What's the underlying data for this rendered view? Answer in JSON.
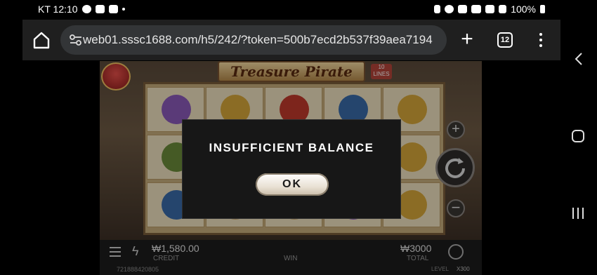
{
  "status_bar": {
    "time": "KT 12:10",
    "battery": "100%"
  },
  "browser": {
    "url": "web01.sssc1688.com/h5/242/?token=500b7ecd2b537f39aea7194",
    "tab_count": "12"
  },
  "game": {
    "title": "Treasure Pirate",
    "lines_badge": "10 LINES",
    "credit_value": "₩1,580.00",
    "credit_label": "CREDIT",
    "win_label": "WIN",
    "total_value": "₩3000",
    "total_label": "TOTAL",
    "round_id": "721888420805",
    "level_label": "LEVEL",
    "level_value": "X300"
  },
  "dialog": {
    "message": "INSUFFICIENT BALANCE",
    "ok_label": "OK"
  },
  "colors": {
    "dialog_bg": "#171717",
    "toolbar_bg": "#1f1f1f",
    "urlbar_bg": "#333537"
  }
}
